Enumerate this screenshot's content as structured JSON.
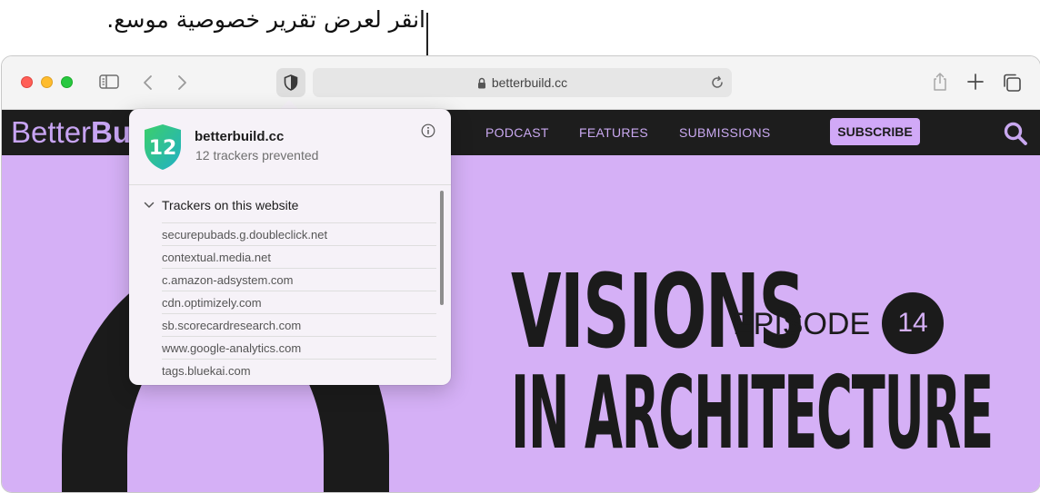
{
  "callout": {
    "text": "انقر لعرض تقرير خصوصية موسع."
  },
  "browser": {
    "url": "betterbuild.cc",
    "icons": [
      "sidebar-icon",
      "back-icon",
      "forward-icon",
      "privacy-shield-icon",
      "lock-icon",
      "reload-icon",
      "share-icon",
      "new-tab-icon",
      "tab-overview-icon"
    ]
  },
  "site": {
    "logo_light": "Better",
    "logo_bold": "Bu",
    "nav": {
      "podcast": "PODCAST",
      "features": "FEATURES",
      "submissions": "SUBMISSIONS",
      "subscribe": "SUBSCRIBE"
    },
    "hero": {
      "title_line1": "VISIONS",
      "title_line2": "IN ARCHITECTURE",
      "episode_label": "EPISODE",
      "episode_number": "14"
    },
    "colors": {
      "hero_bg": "#d5b0f6",
      "nav_bg": "#1d1d1d",
      "accent": "#c9a8f0"
    }
  },
  "privacy_report": {
    "badge_count": "12",
    "site": "betterbuild.cc",
    "summary": "12 trackers prevented",
    "section_title": "Trackers on this website",
    "trackers": [
      "securepubads.g.doubleclick.net",
      "contextual.media.net",
      "c.amazon-adsystem.com",
      "cdn.optimizely.com",
      "sb.scorecardresearch.com",
      "www.google-analytics.com",
      "tags.bluekai.com"
    ],
    "badge_colors": [
      "#35c46a",
      "#2bb5c9"
    ]
  }
}
